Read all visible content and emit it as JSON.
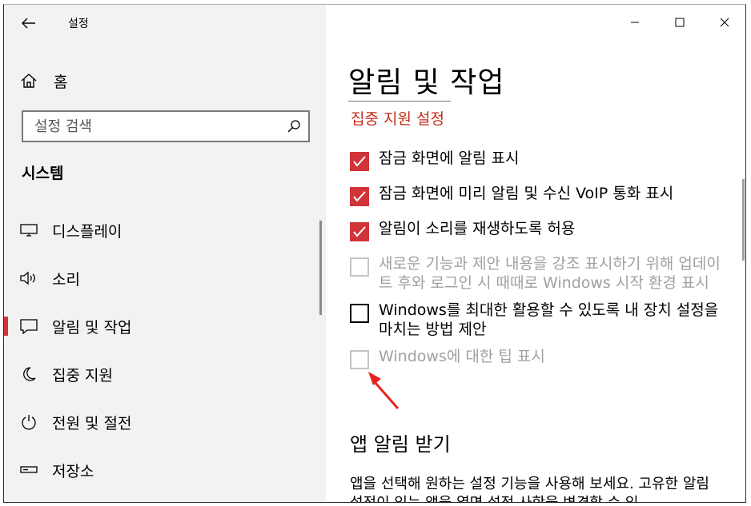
{
  "app": {
    "title": "설정"
  },
  "sidebar": {
    "home_label": "홈",
    "search_placeholder": "설정 검색",
    "section_title": "시스템",
    "items": [
      {
        "label": "디스플레이",
        "icon": "monitor-icon"
      },
      {
        "label": "소리",
        "icon": "speaker-icon"
      },
      {
        "label": "알림 및 작업",
        "icon": "notification-icon",
        "active": true
      },
      {
        "label": "집중 지원",
        "icon": "moon-icon"
      },
      {
        "label": "전원 및 절전",
        "icon": "power-icon"
      },
      {
        "label": "저장소",
        "icon": "storage-icon"
      }
    ]
  },
  "main": {
    "title": "알림 및 작업",
    "focus_link": "집중 지원 설정",
    "options": [
      {
        "text": "잠금 화면에 알림 표시",
        "checked": true,
        "disabled": false
      },
      {
        "text": "잠금 화면에 미리 알림 및 수신 VoIP 통화 표시",
        "checked": true,
        "disabled": false
      },
      {
        "text": "알림이 소리를 재생하도록 허용",
        "checked": true,
        "disabled": false
      },
      {
        "text": "새로운 기능과 제안 내용을 강조 표시하기 위해 업데이트 후와 로그인 시 때때로 Windows 시작 환경 표시",
        "checked": false,
        "disabled": true
      },
      {
        "text": "Windows를 최대한 활용할 수 있도록 내 장치 설정을 마치는 방법 제안",
        "checked": false,
        "disabled": false
      },
      {
        "text": "Windows에 대한 팁 표시",
        "checked": false,
        "disabled": true
      }
    ],
    "section_title": "앱 알림 받기",
    "description": "앱을 선택해 원하는 설정 기능을 사용해 보세요. 고유한 알림 설정이 있는 앱을 열면 설정 사항을 변경할 수 있"
  },
  "colors": {
    "accent": "#d13438",
    "link": "#c42b1c",
    "annotation": "#e8231d"
  }
}
